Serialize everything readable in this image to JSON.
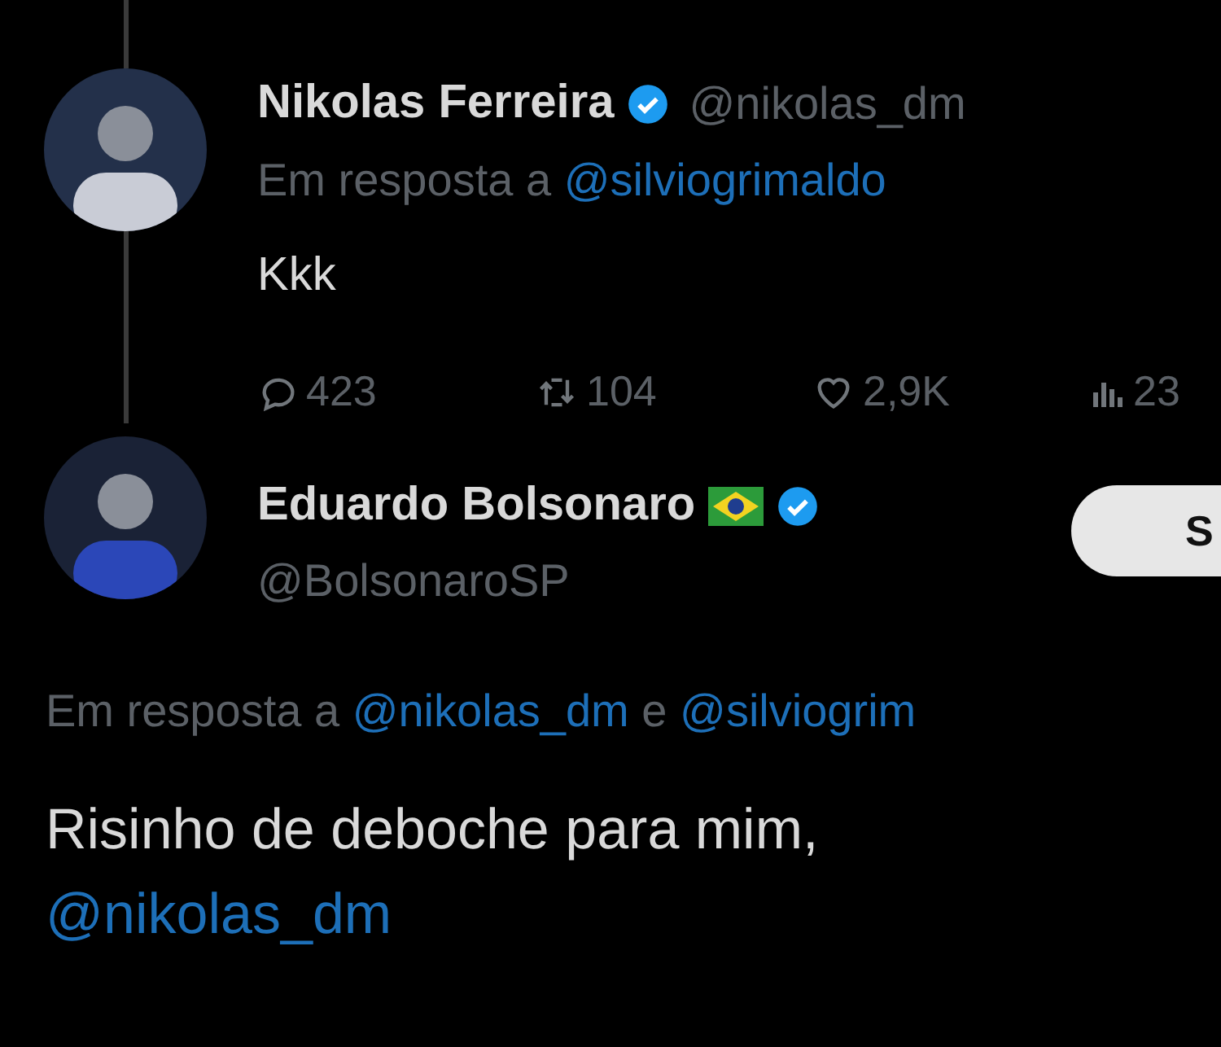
{
  "tweets": [
    {
      "kind": "parent",
      "name": "Nikolas Ferreira",
      "flag": false,
      "verified": true,
      "handle": "@nikolas_dm",
      "reply_to": {
        "label": "Em resposta a",
        "parts": [
          {
            "kind": "mention",
            "text": "@silviogrimaldo"
          }
        ]
      },
      "body": [
        {
          "kind": "text",
          "text": "Kkk"
        }
      ],
      "stats": [
        {
          "kind": "reply",
          "text": "423"
        },
        {
          "kind": "retweet",
          "text": "104"
        },
        {
          "kind": "like",
          "text": "2,9K"
        },
        {
          "kind": "views",
          "text": "23"
        }
      ],
      "thread_line": true
    },
    {
      "kind": "reply",
      "name": "Eduardo Bolsonaro",
      "flag": true,
      "verified": true,
      "handle": "@BolsonaroSP",
      "follow_button": "S",
      "reply_to": {
        "label": "Em resposta a",
        "parts": [
          {
            "kind": "mention",
            "text": "@nikolas_dm"
          },
          {
            "kind": "text",
            "text": "e"
          },
          {
            "kind": "mention",
            "text": "@silviogrim"
          }
        ]
      },
      "body": [
        {
          "kind": "text",
          "text": "Risinho de deboche para mim,"
        },
        {
          "kind": "mention",
          "text": "@nikolas_dm"
        }
      ],
      "thread_line": false
    }
  ]
}
